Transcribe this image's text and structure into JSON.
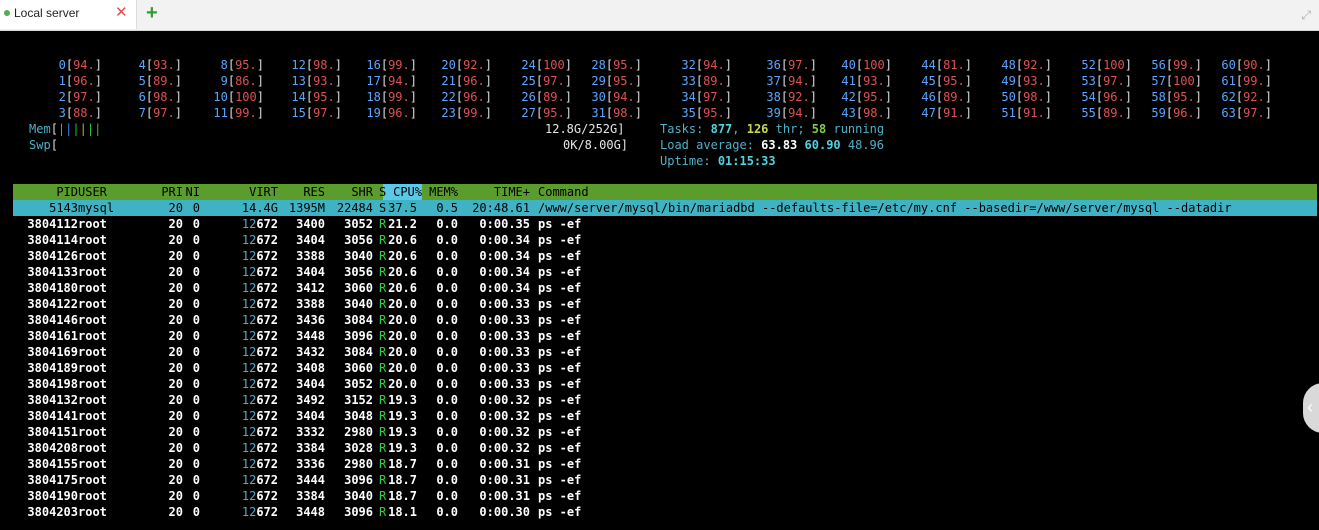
{
  "tab": {
    "title": "Local server",
    "close": "✕",
    "add": "+",
    "expand": "⤢"
  },
  "cpus": [
    {
      "id": "0",
      "val": "94."
    },
    {
      "id": "1",
      "val": "96."
    },
    {
      "id": "2",
      "val": "97."
    },
    {
      "id": "3",
      "val": "88."
    },
    {
      "id": "4",
      "val": "93."
    },
    {
      "id": "5",
      "val": "89."
    },
    {
      "id": "6",
      "val": "98."
    },
    {
      "id": "7",
      "val": "97."
    },
    {
      "id": "8",
      "val": "95."
    },
    {
      "id": "9",
      "val": "86."
    },
    {
      "id": "10",
      "val": "100"
    },
    {
      "id": "11",
      "val": "99."
    },
    {
      "id": "12",
      "val": "98."
    },
    {
      "id": "13",
      "val": "93."
    },
    {
      "id": "14",
      "val": "95."
    },
    {
      "id": "15",
      "val": "97."
    },
    {
      "id": "16",
      "val": "99."
    },
    {
      "id": "17",
      "val": "94."
    },
    {
      "id": "18",
      "val": "99."
    },
    {
      "id": "19",
      "val": "96."
    },
    {
      "id": "20",
      "val": "92."
    },
    {
      "id": "21",
      "val": "96."
    },
    {
      "id": "22",
      "val": "96."
    },
    {
      "id": "23",
      "val": "99."
    },
    {
      "id": "24",
      "val": "100"
    },
    {
      "id": "25",
      "val": "97."
    },
    {
      "id": "26",
      "val": "89."
    },
    {
      "id": "27",
      "val": "95."
    },
    {
      "id": "28",
      "val": "95."
    },
    {
      "id": "29",
      "val": "95."
    },
    {
      "id": "30",
      "val": "94."
    },
    {
      "id": "31",
      "val": "98."
    },
    {
      "id": "32",
      "val": "94."
    },
    {
      "id": "33",
      "val": "89."
    },
    {
      "id": "34",
      "val": "97."
    },
    {
      "id": "35",
      "val": "95."
    },
    {
      "id": "36",
      "val": "97."
    },
    {
      "id": "37",
      "val": "94."
    },
    {
      "id": "38",
      "val": "92."
    },
    {
      "id": "39",
      "val": "94."
    },
    {
      "id": "40",
      "val": "100"
    },
    {
      "id": "41",
      "val": "93."
    },
    {
      "id": "42",
      "val": "95."
    },
    {
      "id": "43",
      "val": "98."
    },
    {
      "id": "44",
      "val": "81."
    },
    {
      "id": "45",
      "val": "95."
    },
    {
      "id": "46",
      "val": "89."
    },
    {
      "id": "47",
      "val": "91."
    },
    {
      "id": "48",
      "val": "92."
    },
    {
      "id": "49",
      "val": "93."
    },
    {
      "id": "50",
      "val": "98."
    },
    {
      "id": "51",
      "val": "91."
    },
    {
      "id": "52",
      "val": "100"
    },
    {
      "id": "53",
      "val": "97."
    },
    {
      "id": "54",
      "val": "96."
    },
    {
      "id": "55",
      "val": "89."
    },
    {
      "id": "56",
      "val": "99."
    },
    {
      "id": "57",
      "val": "100"
    },
    {
      "id": "58",
      "val": "95."
    },
    {
      "id": "59",
      "val": "96."
    },
    {
      "id": "60",
      "val": "90."
    },
    {
      "id": "61",
      "val": "99."
    },
    {
      "id": "62",
      "val": "92."
    },
    {
      "id": "63",
      "val": "97."
    }
  ],
  "mem": {
    "label": "Mem",
    "value": "12.8G/252G"
  },
  "swp": {
    "label": "Swp",
    "value": "0K/8.00G"
  },
  "tasks": {
    "label": "Tasks:",
    "count": "877",
    "thr": "126",
    "thr_label": "thr;",
    "running": "58",
    "running_label": "running"
  },
  "load": {
    "label": "Load average:",
    "l1": "63.83",
    "l5": "60.90",
    "l15": "48.96"
  },
  "uptime": {
    "label": "Uptime:",
    "value": "01:15:33"
  },
  "columns": [
    "PID",
    "USER",
    "PRI",
    "NI",
    "VIRT",
    "RES",
    "SHR",
    "S",
    "CPU%",
    "MEM%",
    "TIME+",
    "Command"
  ],
  "selected": {
    "pid": "5143",
    "user": "mysql",
    "pri": "20",
    "ni": "0",
    "virt": "14.4G",
    "res": "1395M",
    "shr": "22484",
    "s": "S",
    "cpu": "37.5",
    "mem": "0.5",
    "time": "20:48.61",
    "cmd": "/www/server/mysql/bin/mariadbd --defaults-file=/etc/my.cnf --basedir=/www/server/mysql --datadir"
  },
  "processes": [
    {
      "pid": "3804112",
      "user": "root",
      "pri": "20",
      "ni": "0",
      "virt": "12672",
      "res": "3400",
      "shr": "3052",
      "s": "R",
      "cpu": "21.2",
      "mem": "0.0",
      "time": "0:00.35",
      "cmd": "ps -ef"
    },
    {
      "pid": "3804114",
      "user": "root",
      "pri": "20",
      "ni": "0",
      "virt": "12672",
      "res": "3404",
      "shr": "3056",
      "s": "R",
      "cpu": "20.6",
      "mem": "0.0",
      "time": "0:00.34",
      "cmd": "ps -ef"
    },
    {
      "pid": "3804126",
      "user": "root",
      "pri": "20",
      "ni": "0",
      "virt": "12672",
      "res": "3388",
      "shr": "3040",
      "s": "R",
      "cpu": "20.6",
      "mem": "0.0",
      "time": "0:00.34",
      "cmd": "ps -ef"
    },
    {
      "pid": "3804133",
      "user": "root",
      "pri": "20",
      "ni": "0",
      "virt": "12672",
      "res": "3404",
      "shr": "3056",
      "s": "R",
      "cpu": "20.6",
      "mem": "0.0",
      "time": "0:00.34",
      "cmd": "ps -ef"
    },
    {
      "pid": "3804180",
      "user": "root",
      "pri": "20",
      "ni": "0",
      "virt": "12672",
      "res": "3412",
      "shr": "3060",
      "s": "R",
      "cpu": "20.6",
      "mem": "0.0",
      "time": "0:00.34",
      "cmd": "ps -ef"
    },
    {
      "pid": "3804122",
      "user": "root",
      "pri": "20",
      "ni": "0",
      "virt": "12672",
      "res": "3388",
      "shr": "3040",
      "s": "R",
      "cpu": "20.0",
      "mem": "0.0",
      "time": "0:00.33",
      "cmd": "ps -ef"
    },
    {
      "pid": "3804146",
      "user": "root",
      "pri": "20",
      "ni": "0",
      "virt": "12672",
      "res": "3436",
      "shr": "3084",
      "s": "R",
      "cpu": "20.0",
      "mem": "0.0",
      "time": "0:00.33",
      "cmd": "ps -ef"
    },
    {
      "pid": "3804161",
      "user": "root",
      "pri": "20",
      "ni": "0",
      "virt": "12672",
      "res": "3448",
      "shr": "3096",
      "s": "R",
      "cpu": "20.0",
      "mem": "0.0",
      "time": "0:00.33",
      "cmd": "ps -ef"
    },
    {
      "pid": "3804169",
      "user": "root",
      "pri": "20",
      "ni": "0",
      "virt": "12672",
      "res": "3432",
      "shr": "3084",
      "s": "R",
      "cpu": "20.0",
      "mem": "0.0",
      "time": "0:00.33",
      "cmd": "ps -ef"
    },
    {
      "pid": "3804189",
      "user": "root",
      "pri": "20",
      "ni": "0",
      "virt": "12672",
      "res": "3408",
      "shr": "3060",
      "s": "R",
      "cpu": "20.0",
      "mem": "0.0",
      "time": "0:00.33",
      "cmd": "ps -ef"
    },
    {
      "pid": "3804198",
      "user": "root",
      "pri": "20",
      "ni": "0",
      "virt": "12672",
      "res": "3404",
      "shr": "3052",
      "s": "R",
      "cpu": "20.0",
      "mem": "0.0",
      "time": "0:00.33",
      "cmd": "ps -ef"
    },
    {
      "pid": "3804132",
      "user": "root",
      "pri": "20",
      "ni": "0",
      "virt": "12672",
      "res": "3492",
      "shr": "3152",
      "s": "R",
      "cpu": "19.3",
      "mem": "0.0",
      "time": "0:00.32",
      "cmd": "ps -ef"
    },
    {
      "pid": "3804141",
      "user": "root",
      "pri": "20",
      "ni": "0",
      "virt": "12672",
      "res": "3404",
      "shr": "3048",
      "s": "R",
      "cpu": "19.3",
      "mem": "0.0",
      "time": "0:00.32",
      "cmd": "ps -ef"
    },
    {
      "pid": "3804151",
      "user": "root",
      "pri": "20",
      "ni": "0",
      "virt": "12672",
      "res": "3332",
      "shr": "2980",
      "s": "R",
      "cpu": "19.3",
      "mem": "0.0",
      "time": "0:00.32",
      "cmd": "ps -ef"
    },
    {
      "pid": "3804208",
      "user": "root",
      "pri": "20",
      "ni": "0",
      "virt": "12672",
      "res": "3384",
      "shr": "3028",
      "s": "R",
      "cpu": "19.3",
      "mem": "0.0",
      "time": "0:00.32",
      "cmd": "ps -ef"
    },
    {
      "pid": "3804155",
      "user": "root",
      "pri": "20",
      "ni": "0",
      "virt": "12672",
      "res": "3336",
      "shr": "2980",
      "s": "R",
      "cpu": "18.7",
      "mem": "0.0",
      "time": "0:00.31",
      "cmd": "ps -ef"
    },
    {
      "pid": "3804175",
      "user": "root",
      "pri": "20",
      "ni": "0",
      "virt": "12672",
      "res": "3444",
      "shr": "3096",
      "s": "R",
      "cpu": "18.7",
      "mem": "0.0",
      "time": "0:00.31",
      "cmd": "ps -ef"
    },
    {
      "pid": "3804190",
      "user": "root",
      "pri": "20",
      "ni": "0",
      "virt": "12672",
      "res": "3384",
      "shr": "3040",
      "s": "R",
      "cpu": "18.7",
      "mem": "0.0",
      "time": "0:00.31",
      "cmd": "ps -ef"
    },
    {
      "pid": "3804203",
      "user": "root",
      "pri": "20",
      "ni": "0",
      "virt": "12672",
      "res": "3448",
      "shr": "3096",
      "s": "R",
      "cpu": "18.1",
      "mem": "0.0",
      "time": "0:00.30",
      "cmd": "ps -ef"
    }
  ],
  "colors": {
    "header": "#5b9d2d",
    "cpu_header": "#5bc8e8",
    "selected_row": "#3fb3c3",
    "status_running": "#3cc83c",
    "tab_close": "#e84a4a",
    "tab_add": "#2e9d2e"
  },
  "icons": {
    "status": "green-dot-icon",
    "close": "close-icon",
    "add": "plus-icon",
    "expand": "expand-icon",
    "collapse": "chevron-left-icon"
  }
}
